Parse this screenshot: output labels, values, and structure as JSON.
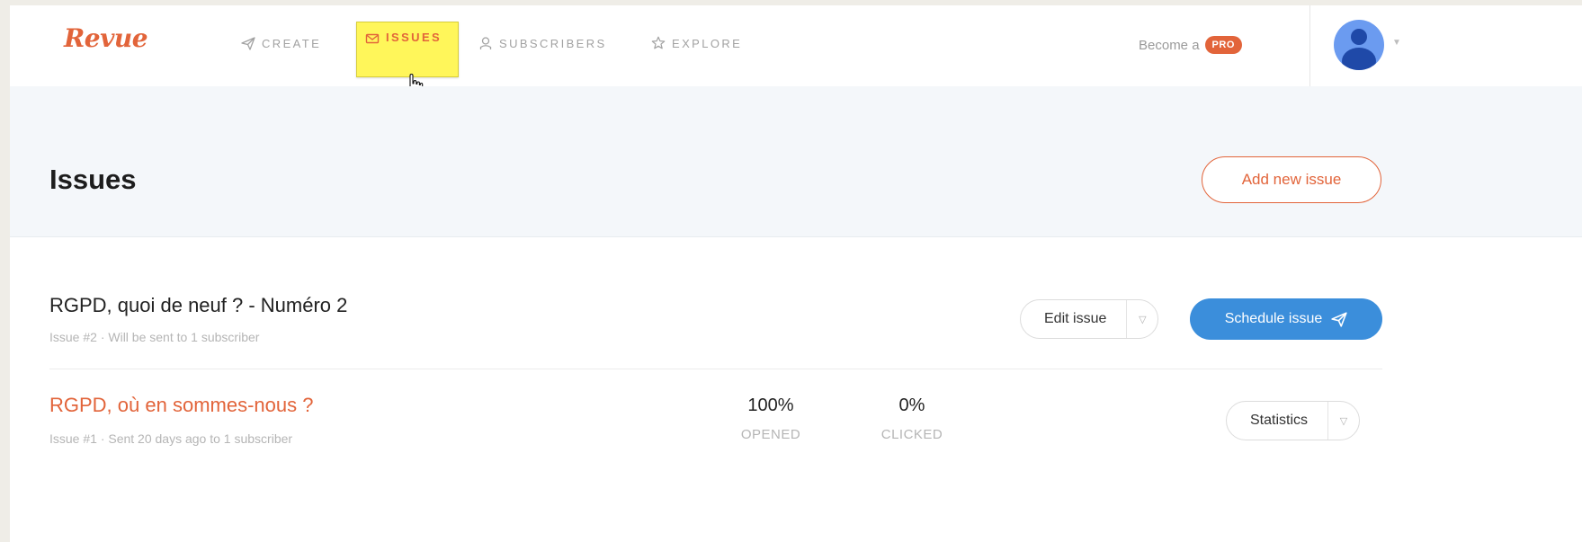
{
  "brand": {
    "logo": "Revue",
    "accent": "#e2643a",
    "highlight": "#fff65a",
    "primary": "#3b8edb"
  },
  "nav": {
    "create": {
      "label": "CREATE",
      "icon": "paper-plane-icon"
    },
    "issues": {
      "label": "ISSUES",
      "icon": "envelope-icon",
      "active": true
    },
    "subscribers": {
      "label": "SUBSCRIBERS",
      "icon": "user-icon"
    },
    "explore": {
      "label": "EXPLORE",
      "icon": "star-icon"
    }
  },
  "account": {
    "become_label": "Become a",
    "pro_badge": "PRO",
    "avatar_icon": "user-avatar-icon"
  },
  "page": {
    "title": "Issues",
    "add_button": "Add new issue"
  },
  "issues": [
    {
      "title": "RGPD, quoi de neuf ? - Numéro 2",
      "meta": "Issue #2  ·  Will be sent to 1 subscriber",
      "primary_action": "Edit issue",
      "secondary_action": "Schedule issue"
    },
    {
      "title": "RGPD, où en sommes-nous ?",
      "meta": "Issue #1  ·  Sent 20 days ago to 1 subscriber",
      "opened_value": "100%",
      "opened_label": "OPENED",
      "clicked_value": "0%",
      "clicked_label": "CLICKED",
      "primary_action": "Statistics"
    }
  ]
}
